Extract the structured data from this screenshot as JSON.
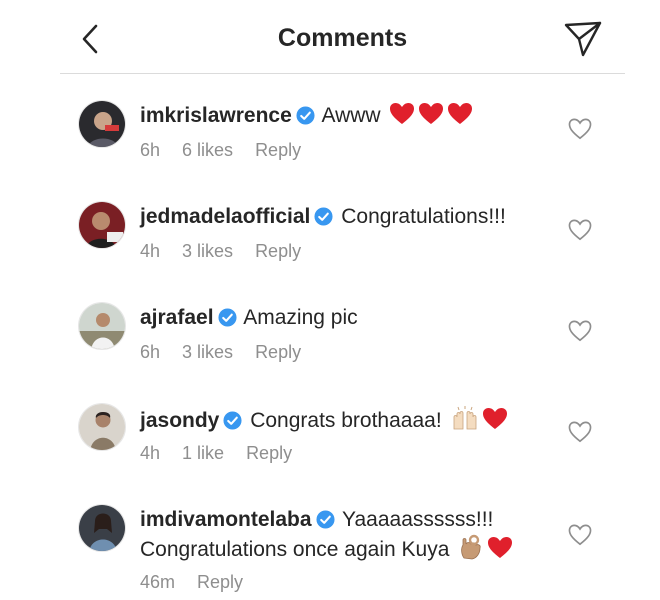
{
  "header": {
    "title": "Comments",
    "back_icon": "chevron-left-icon",
    "send_icon": "paper-plane-icon"
  },
  "colors": {
    "text": "#262626",
    "muted": "#8e8e8e",
    "verified_blue": "#3897f0",
    "heart_red": "#e0202c",
    "divider": "#dbdbdb"
  },
  "comments": [
    {
      "username": "imkrislawrence",
      "verified": true,
      "text": "Awww",
      "text_line2": "",
      "emojis": [
        "red-heart",
        "red-heart",
        "red-heart"
      ],
      "time": "6h",
      "likes": "6 likes",
      "reply": "Reply"
    },
    {
      "username": "jedmadelaofficial",
      "verified": true,
      "text": "Congratulations!!!",
      "text_line2": "",
      "emojis": [],
      "time": "4h",
      "likes": "3 likes",
      "reply": "Reply"
    },
    {
      "username": "ajrafael",
      "verified": true,
      "text": "Amazing pic",
      "text_line2": "",
      "emojis": [],
      "time": "6h",
      "likes": "3 likes",
      "reply": "Reply"
    },
    {
      "username": "jasondy",
      "verified": true,
      "text": "Congrats brothaaaa!",
      "text_line2": "",
      "emojis": [
        "raising-hands",
        "red-heart"
      ],
      "time": "4h",
      "likes": "1 like",
      "reply": "Reply"
    },
    {
      "username": "imdivamontelaba",
      "verified": true,
      "text": "Yaaaaassssss!!!",
      "text_line2": "Congratulations once again Kuya",
      "emojis": [
        "ok-hand",
        "red-heart"
      ],
      "time": "46m",
      "likes": "",
      "reply": "Reply"
    }
  ]
}
